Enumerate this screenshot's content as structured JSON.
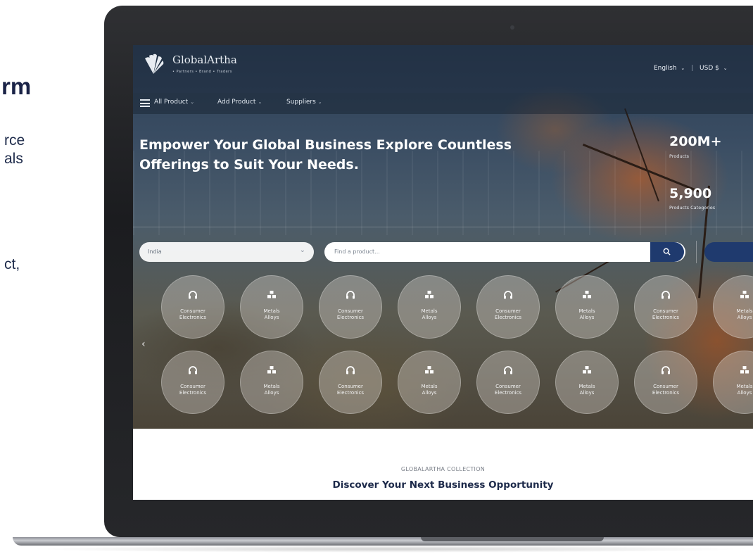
{
  "slide": {
    "heading_fragment": "rm",
    "line1": "rce",
    "line2": "als",
    "line3": "ct,"
  },
  "header": {
    "brand": "GlobalArtha",
    "tagline": "• Partners • Brand • Traders",
    "language": "English",
    "currency": "USD $"
  },
  "nav": {
    "items": [
      "All Product",
      "Add Product",
      "Suppliers"
    ]
  },
  "hero": {
    "headline_line1": "Empower Your Global Business Explore Countless",
    "headline_line2": "Offerings to Suit Your Needs.",
    "stats": [
      {
        "value": "200M+",
        "label": "Products"
      },
      {
        "value": "5,900",
        "label": "Products Categories"
      }
    ]
  },
  "search": {
    "country_value": "India",
    "placeholder": "Find a product..."
  },
  "categories": {
    "row1": [
      {
        "l1": "Consumer",
        "l2": "Electronics",
        "icon": "headphones-icon"
      },
      {
        "l1": "Metals",
        "l2": "Alloys",
        "icon": "metals-icon"
      },
      {
        "l1": "Consumer",
        "l2": "Electronics",
        "icon": "headphones-icon"
      },
      {
        "l1": "Metals",
        "l2": "Alloys",
        "icon": "metals-icon"
      },
      {
        "l1": "Consumer",
        "l2": "Electronics",
        "icon": "headphones-icon"
      },
      {
        "l1": "Metals",
        "l2": "Alloys",
        "icon": "metals-icon"
      },
      {
        "l1": "Consumer",
        "l2": "Electronics",
        "icon": "headphones-icon"
      },
      {
        "l1": "Metals",
        "l2": "Alloys",
        "icon": "metals-icon"
      }
    ],
    "row2": [
      {
        "l1": "Consumer",
        "l2": "Electronics",
        "icon": "headphones-icon"
      },
      {
        "l1": "Metals",
        "l2": "Alloys",
        "icon": "metals-icon"
      },
      {
        "l1": "Consumer",
        "l2": "Electronics",
        "icon": "headphones-icon"
      },
      {
        "l1": "Metals",
        "l2": "Alloys",
        "icon": "metals-icon"
      },
      {
        "l1": "Consumer",
        "l2": "Electronics",
        "icon": "headphones-icon"
      },
      {
        "l1": "Metals",
        "l2": "Alloys",
        "icon": "metals-icon"
      },
      {
        "l1": "Consumer",
        "l2": "Electronics",
        "icon": "headphones-icon"
      },
      {
        "l1": "Metals",
        "l2": "Alloys",
        "icon": "metals-icon"
      }
    ]
  },
  "collection": {
    "kicker": "GLOBALARTHA COLLECTION",
    "title": "Discover Your Next Business Opportunity"
  },
  "colors": {
    "navy": "#1d2a4a",
    "button_blue": "#1f3a6e"
  }
}
